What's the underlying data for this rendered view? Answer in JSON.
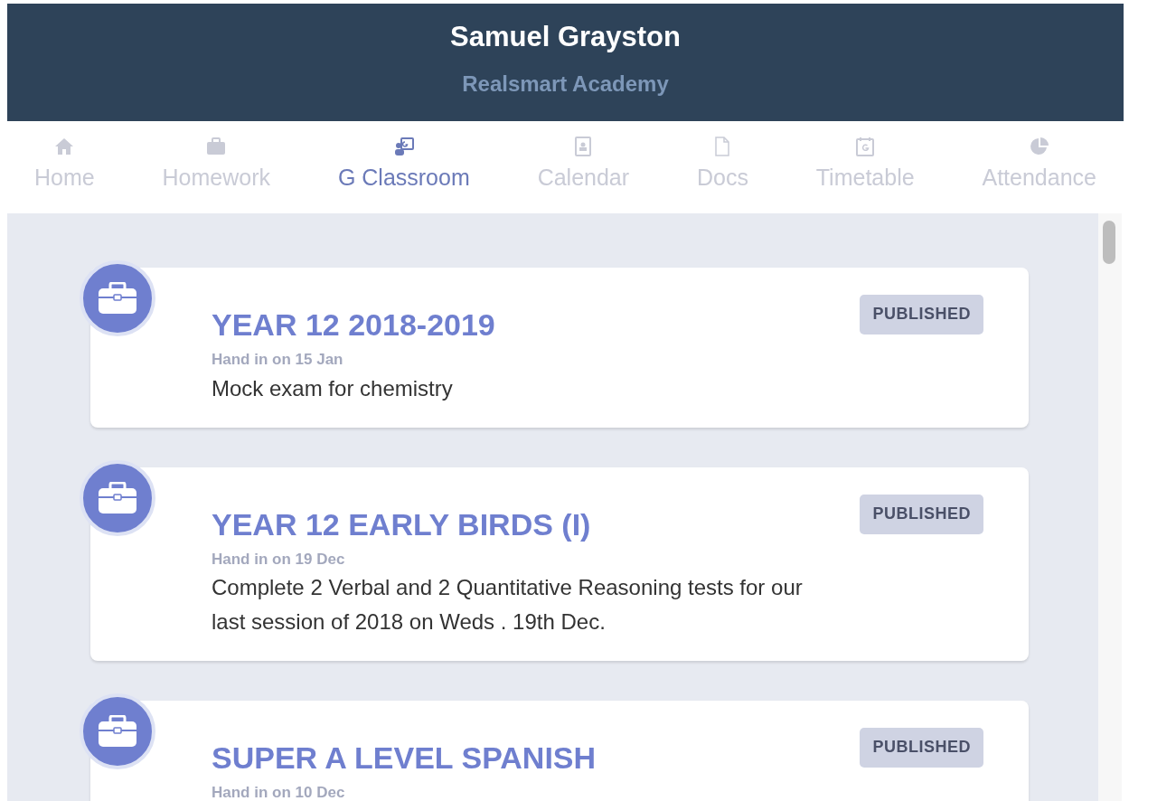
{
  "header": {
    "name": "Samuel Grayston",
    "school": "Realsmart Academy"
  },
  "tabs": [
    {
      "label": "Home",
      "kind": "home",
      "selected": false
    },
    {
      "label": "Homework",
      "kind": "briefcase",
      "selected": false
    },
    {
      "label": "G Classroom",
      "kind": "classroom",
      "selected": true
    },
    {
      "label": "Calendar",
      "kind": "calendar",
      "selected": false
    },
    {
      "label": "Docs",
      "kind": "doc",
      "selected": false
    },
    {
      "label": "Timetable",
      "kind": "timetable",
      "selected": false
    },
    {
      "label": "Attendance",
      "kind": "pie",
      "selected": false
    }
  ],
  "assignments": [
    {
      "title": "YEAR 12 2018-2019",
      "due": "Hand in on 15 Jan",
      "description": "Mock exam for chemistry",
      "status": "PUBLISHED"
    },
    {
      "title": "YEAR 12 EARLY BIRDS (I)",
      "due": "Hand in on 19 Dec",
      "description": "Complete 2 Verbal and 2 Quantitative Reasoning tests for our last session of 2018 on Weds . 19th Dec.",
      "status": "PUBLISHED"
    },
    {
      "title": "SUPER A LEVEL SPANISH",
      "due": "Hand in on 10 Dec",
      "status": "PUBLISHED"
    }
  ]
}
